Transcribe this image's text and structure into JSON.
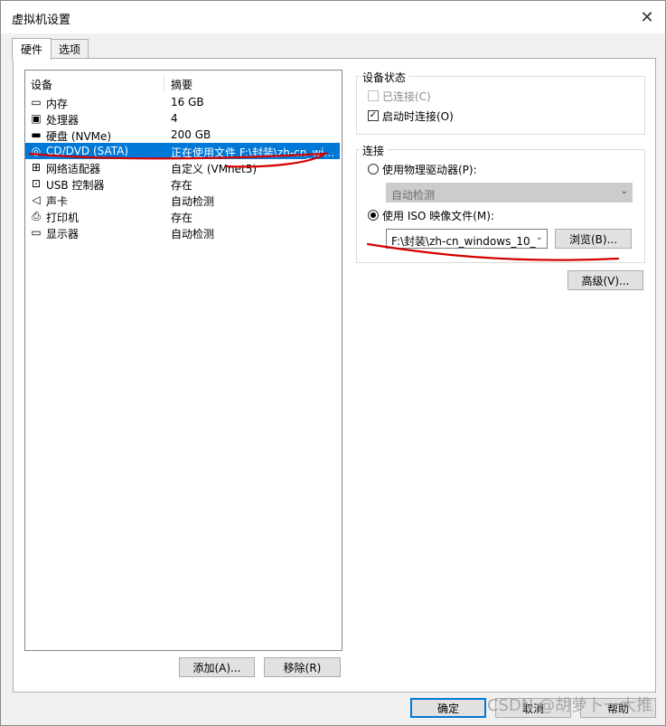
{
  "window": {
    "title": "虚拟机设置",
    "close_glyph": "✕"
  },
  "tabs": [
    {
      "label": "硬件",
      "active": true
    },
    {
      "label": "选项",
      "active": false
    }
  ],
  "device_table": {
    "columns": [
      "设备",
      "摘要"
    ],
    "rows": [
      {
        "icon": "memory-icon",
        "name": "内存",
        "summary": "16 GB"
      },
      {
        "icon": "cpu-icon",
        "name": "处理器",
        "summary": "4"
      },
      {
        "icon": "disk-icon",
        "name": "硬盘 (NVMe)",
        "summary": "200 GB"
      },
      {
        "icon": "cd-icon",
        "name": "CD/DVD (SATA)",
        "summary": "正在使用文件 F:\\封装\\zh-cn_wi...",
        "selected": true
      },
      {
        "icon": "network-icon",
        "name": "网络适配器",
        "summary": "自定义 (VMnet5)"
      },
      {
        "icon": "usb-icon",
        "name": "USB 控制器",
        "summary": "存在"
      },
      {
        "icon": "sound-icon",
        "name": "声卡",
        "summary": "自动检测"
      },
      {
        "icon": "printer-icon",
        "name": "打印机",
        "summary": "存在"
      },
      {
        "icon": "display-icon",
        "name": "显示器",
        "summary": "自动检测"
      }
    ]
  },
  "list_buttons": {
    "add": "添加(A)...",
    "remove": "移除(R)"
  },
  "device_status": {
    "label": "设备状态",
    "connected": {
      "label": "已连接(C)",
      "checked": false,
      "disabled": true
    },
    "connect_on_start": {
      "label": "启动时连接(O)",
      "checked": true
    }
  },
  "connection": {
    "label": "连接",
    "physical": {
      "label": "使用物理驱动器(P):",
      "selected": false,
      "combo_value": "自动检测"
    },
    "iso": {
      "label": "使用 ISO 映像文件(M):",
      "selected": true,
      "combo_value": "F:\\封装\\zh-cn_windows_10_"
    },
    "browse": "浏览(B)..."
  },
  "advanced": "高级(V)...",
  "footer": {
    "ok": "确定",
    "cancel": "取消",
    "help": "帮助"
  },
  "watermark": "CSDN @胡萝卜一大推",
  "colors": {
    "selection": "#0078d7",
    "annotation": "#d40000"
  }
}
